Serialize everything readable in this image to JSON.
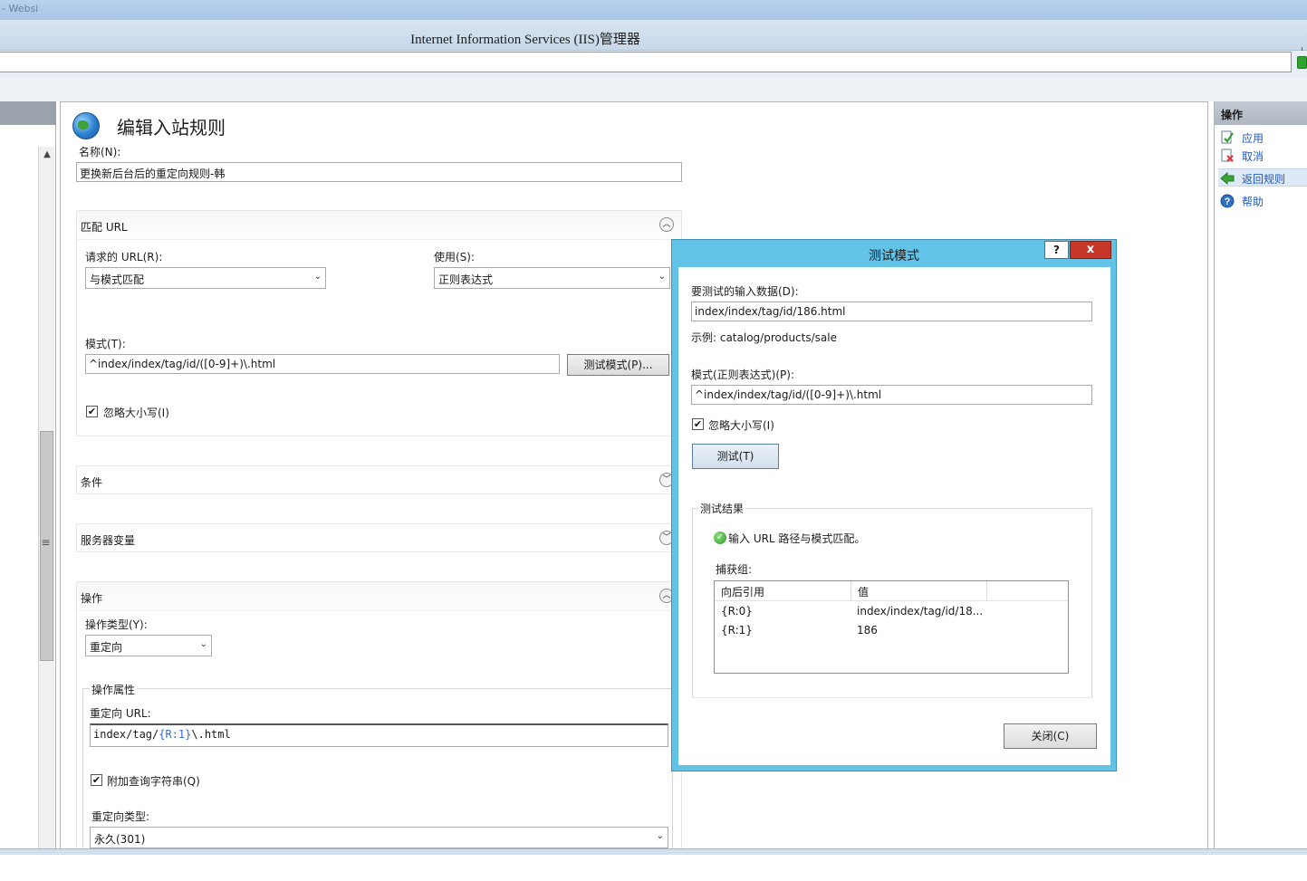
{
  "window": {
    "top_strip_text": "- Websi",
    "title": "Internet Information Services (IIS)管理器"
  },
  "left_pane": {
    "scroll_up": "▲",
    "grip": "≡"
  },
  "editor": {
    "title": "编辑入站规则",
    "name_label": "名称(N):",
    "name_value": "更换新后台后的重定向规则-韩",
    "match_url": {
      "title": "匹配 URL",
      "requested_url_label": "请求的 URL(R):",
      "requested_url_value": "与模式匹配",
      "using_label": "使用(S):",
      "using_value": "正则表达式",
      "pattern_label": "模式(T):",
      "pattern_value": "^index/index/tag/id/([0-9]+)\\.html",
      "test_button": "测试模式(P)...",
      "ignore_case_label": "忽略大小写(I)",
      "ignore_case_checked": true
    },
    "conditions": {
      "title": "条件"
    },
    "server_variables": {
      "title": "服务器变量"
    },
    "action": {
      "title": "操作",
      "action_type_label": "操作类型(Y):",
      "action_type_value": "重定向",
      "properties_title": "操作属性",
      "redirect_url_label": "重定向 URL:",
      "redirect_url_part1": "index/tag/",
      "redirect_url_token": "{R:1}",
      "redirect_url_part2": "\\.html",
      "append_query_label": "附加查询字符串(Q)",
      "append_query_checked": true,
      "redirect_type_label": "重定向类型:",
      "redirect_type_value": "永久(301)"
    }
  },
  "actions_pane": {
    "header": "操作",
    "items": [
      {
        "label": "应用",
        "icon": "apply-icon"
      },
      {
        "label": "取消",
        "icon": "cancel-icon"
      },
      {
        "label": "返回规则",
        "icon": "back-arrow-icon"
      },
      {
        "label": "帮助",
        "icon": "help-icon"
      }
    ]
  },
  "dialog": {
    "title": "测试模式",
    "help_button": "?",
    "close_x": "x",
    "input_label": "要测试的输入数据(D):",
    "input_value": "index/index/tag/id/186.html",
    "example_text": "示例: catalog/products/sale",
    "pattern_label": "模式(正则表达式)(P):",
    "pattern_value": "^index/index/tag/id/([0-9]+)\\.html",
    "ignore_case_label": "忽略大小写(I)",
    "ignore_case_checked": true,
    "test_button": "测试(T)",
    "results_title": "测试结果",
    "result_message": "输入 URL 路径与模式匹配。",
    "capture_groups_label": "捕获组:",
    "columns": [
      "向后引用",
      "值"
    ],
    "rows": [
      {
        "ref": "{R:0}",
        "value": "index/index/tag/id/18..."
      },
      {
        "ref": "{R:1}",
        "value": "186"
      }
    ],
    "close_button": "关闭(C)"
  }
}
